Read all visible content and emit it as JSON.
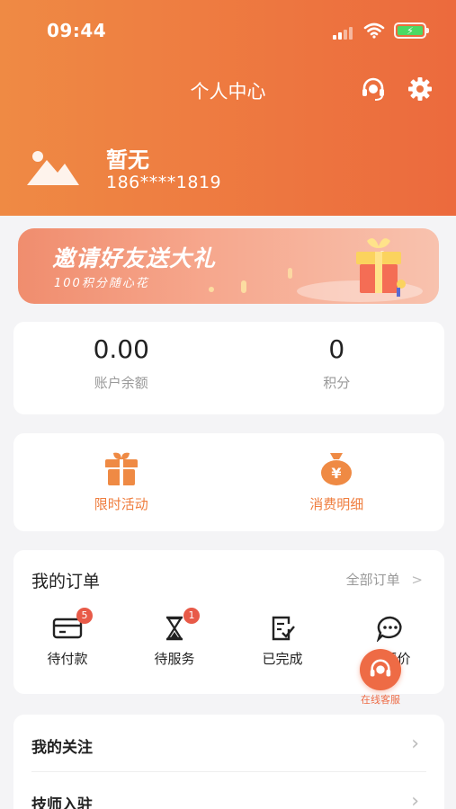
{
  "status_bar": {
    "time": "09:44"
  },
  "header": {
    "title": "个人中心",
    "user_name": "暂无",
    "user_phone": "186****1819"
  },
  "banner": {
    "title": "邀请好友送大礼",
    "subtitle": "100积分随心花"
  },
  "stats": {
    "balance_value": "0.00",
    "balance_label": "账户余额",
    "points_value": "0",
    "points_label": "积分"
  },
  "features": {
    "activity_label": "限时活动",
    "spending_label": "消费明细"
  },
  "orders": {
    "title": "我的订单",
    "all_label": "全部订单",
    "items": [
      {
        "label": "待付款",
        "badge": "5"
      },
      {
        "label": "待服务",
        "badge": "1"
      },
      {
        "label": "已完成",
        "badge": ""
      },
      {
        "label": "待评价",
        "badge": ""
      }
    ]
  },
  "menu": {
    "follow_label": "我的关注",
    "technician_label": "技师入驻"
  },
  "floating": {
    "service_label": "在线客服"
  },
  "colors": {
    "brand": "#ef7d3e",
    "header_start": "#ef8a44",
    "header_end": "#ec6a3d",
    "badge": "#e85a48"
  }
}
